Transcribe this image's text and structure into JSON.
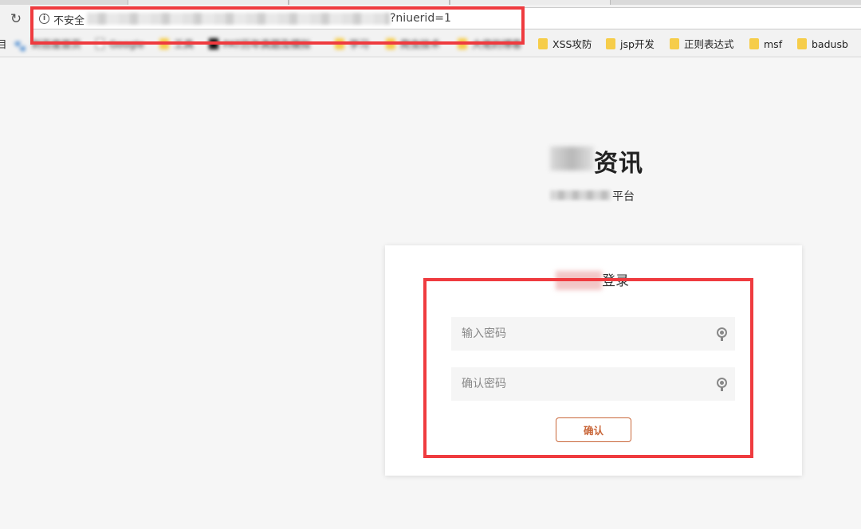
{
  "browser": {
    "security_label": "不安全",
    "url_visible_suffix": "?niuerid=1",
    "bookmarks": [
      {
        "label": "到百度首页",
        "icon": "paw-icon"
      },
      {
        "label": "Google",
        "icon": "page-icon"
      },
      {
        "label": "工具",
        "icon": "folder-icon"
      },
      {
        "label": "PAT历年真题及模拟",
        "icon": "black-square-icon"
      },
      {
        "label": "学习",
        "icon": "folder-icon"
      },
      {
        "label": "爬虫技术",
        "icon": "folder-icon"
      },
      {
        "label": "大佬的博客",
        "icon": "folder-icon"
      },
      {
        "label": "XSS攻防",
        "icon": "folder-icon"
      },
      {
        "label": "jsp开发",
        "icon": "folder-icon"
      },
      {
        "label": "正则表达式",
        "icon": "folder-icon"
      },
      {
        "label": "msf",
        "icon": "folder-icon"
      },
      {
        "label": "badusb",
        "icon": "folder-icon"
      }
    ],
    "partial_left_glyph": "目"
  },
  "page": {
    "brand_text": "资讯",
    "platform_text": "平台",
    "login_title": "登录",
    "password_placeholder": "输入密码",
    "confirm_password_placeholder": "确认密码",
    "confirm_button": "确认"
  },
  "colors": {
    "highlight": "#ef3b3f",
    "button_accent": "#c9673a",
    "page_background": "#f6f6f6"
  }
}
